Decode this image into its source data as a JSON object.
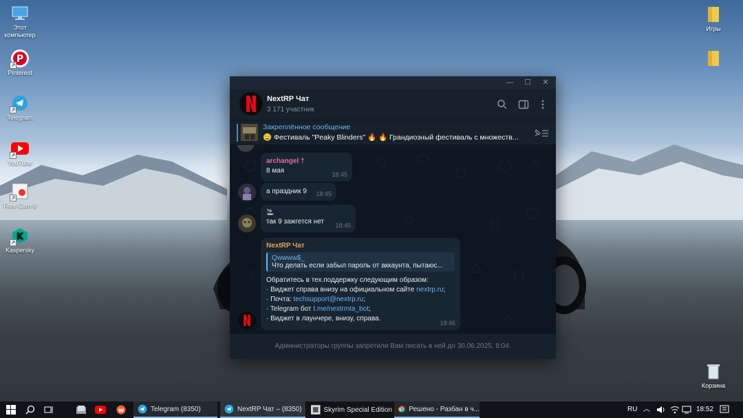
{
  "desktop": {
    "icons_left": [
      {
        "label": "Этот\nкомпьютер",
        "icon": "computer-icon"
      },
      {
        "label": "Pinterest",
        "icon": "pinterest-icon"
      },
      {
        "label": "Telegram",
        "icon": "telegram-icon"
      },
      {
        "label": "YouTube",
        "icon": "youtube-icon"
      },
      {
        "label": "Free Cam 8",
        "icon": "freecam-icon"
      },
      {
        "label": "Kaspersky",
        "icon": "kaspersky-icon"
      }
    ],
    "icons_right": [
      {
        "label": "Игры",
        "icon": "folder-icon"
      },
      {
        "label": "",
        "icon": "folder-icon"
      },
      {
        "label": "Корзина",
        "icon": "recycle-bin-icon"
      }
    ]
  },
  "telegram": {
    "chat_title": "NextRP Чат",
    "chat_subtitle": "3 171 участник",
    "pinned": {
      "title": "Закреплённое сообщение",
      "text": "🤤 Фестиваль \"Peaky Blinders\" 🔥 🔥 Грандиозный фестиваль с множеств..."
    },
    "messages": [
      {
        "author": "archangel †",
        "text": "8 мая",
        "time": "18:45"
      },
      {
        "text": "а праздник 9",
        "time": "18:45"
      },
      {
        "emoji": "🚬",
        "text": "так 9 зажгется нет",
        "time": "18:45"
      },
      {
        "author": "NextRP Чат",
        "reply_author": "Qwwww$_",
        "reply_text": "Что делать если забыл пароль от аккаунта, пытаюс...",
        "lines": [
          {
            "text": "Обратитесь в тех.поддержку следующим образом:",
            "link": ""
          },
          {
            "text": "· Виджет справа внизу на официальном сайте ",
            "link": "nextrp.ru",
            "tail": ";"
          },
          {
            "text": "· Почта: ",
            "link": "techsupport@nextrp.ru",
            "tail": ";"
          },
          {
            "text": "· Telegram бот ",
            "link": "t.me/nextrmta_bot",
            "tail": ";"
          },
          {
            "text": "· Виджет в лаунчере, внизу, справа.",
            "link": ""
          }
        ],
        "time": "18:46"
      }
    ],
    "footer_notice": "Администраторы группы запретили Вам писать в ней до 30.06.2025, 8:04."
  },
  "taskbar": {
    "apps": [
      {
        "label": "Telegram (8350)",
        "icon": "telegram-icon"
      },
      {
        "label": "NextRP Чат – (8350)",
        "icon": "telegram-icon"
      },
      {
        "label": "Skyrim Special Edition",
        "icon": "skyrim-icon"
      },
      {
        "label": "Решено - Разбан в ч...",
        "icon": "chrome-icon"
      }
    ],
    "language": "RU",
    "time": "18:52"
  },
  "colors": {
    "window_bg": "#17212b",
    "chat_bg": "#0e1621",
    "bubble": "#182533",
    "accent": "#6ab3f3",
    "archangel": "#e56b9d",
    "admin": "#e8a24a"
  }
}
